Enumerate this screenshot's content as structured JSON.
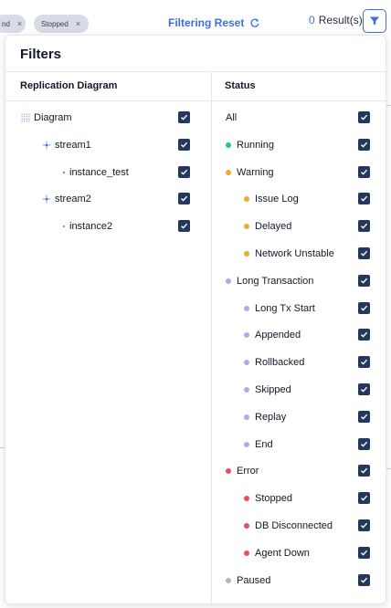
{
  "chips": [
    {
      "label": "nd",
      "close": "×"
    },
    {
      "label": "Stopped",
      "close": "×"
    }
  ],
  "toolbar": {
    "reset_label": "Filtering Reset",
    "result_count": "0",
    "result_label": "Result(s)"
  },
  "popup": {
    "title": "Filters",
    "left_header": "Replication Diagram",
    "right_header": "Status"
  },
  "tree": [
    {
      "label": "Diagram",
      "icon": "grid-icon",
      "level": 0,
      "checked": true
    },
    {
      "label": "stream1",
      "icon": "stream-icon",
      "level": 1,
      "checked": true
    },
    {
      "label": "instance_test",
      "icon": "instance-dot-icon",
      "level": 2,
      "checked": true
    },
    {
      "label": "stream2",
      "icon": "stream-icon",
      "level": 1,
      "checked": true
    },
    {
      "label": "instance2",
      "icon": "instance-dot-icon",
      "level": 2,
      "checked": true
    }
  ],
  "status": [
    {
      "label": "All",
      "color": "",
      "level": 0,
      "checked": true
    },
    {
      "label": "Running",
      "color": "#22c58b",
      "level": 0,
      "checked": true
    },
    {
      "label": "Warning",
      "color": "#f0a830",
      "level": 0,
      "checked": true
    },
    {
      "label": "Issue Log",
      "color": "#f0a830",
      "level": 1,
      "checked": true
    },
    {
      "label": "Delayed",
      "color": "#f0a830",
      "level": 1,
      "checked": true
    },
    {
      "label": "Network Unstable",
      "color": "#f0a830",
      "level": 1,
      "checked": true
    },
    {
      "label": "Long Transaction",
      "color": "#b6a8ee",
      "level": 0,
      "checked": true
    },
    {
      "label": "Long Tx Start",
      "color": "#b6a8ee",
      "level": 1,
      "checked": true
    },
    {
      "label": "Appended",
      "color": "#b6a8ee",
      "level": 1,
      "checked": true
    },
    {
      "label": "Rollbacked",
      "color": "#b6a8ee",
      "level": 1,
      "checked": true
    },
    {
      "label": "Skipped",
      "color": "#b6a8ee",
      "level": 1,
      "checked": true
    },
    {
      "label": "Replay",
      "color": "#b6a8ee",
      "level": 1,
      "checked": true
    },
    {
      "label": "End",
      "color": "#b6a8ee",
      "level": 1,
      "checked": true
    },
    {
      "label": "Error",
      "color": "#f04a5f",
      "level": 0,
      "checked": true
    },
    {
      "label": "Stopped",
      "color": "#f04a5f",
      "level": 1,
      "checked": true
    },
    {
      "label": "DB Disconnected",
      "color": "#f04a5f",
      "level": 1,
      "checked": true
    },
    {
      "label": "Agent Down",
      "color": "#f04a5f",
      "level": 1,
      "checked": true
    },
    {
      "label": "Paused",
      "color": "#b5b5b5",
      "level": 0,
      "checked": true
    }
  ],
  "colors": {
    "accent": "#3b6fe0",
    "checkbox": "#24385f"
  }
}
